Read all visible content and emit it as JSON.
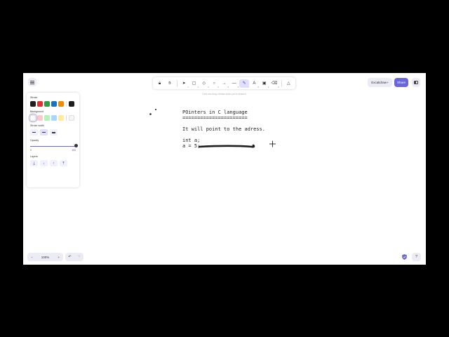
{
  "toolbar": {
    "tools": [
      {
        "name": "lock-tool",
        "glyph": "🔒︎",
        "num": ""
      },
      {
        "name": "hand-tool",
        "glyph": "✋︎",
        "num": ""
      },
      {
        "name": "selection-tool",
        "glyph": "➤",
        "num": "1"
      },
      {
        "name": "rectangle-tool",
        "glyph": "▢",
        "num": "2"
      },
      {
        "name": "diamond-tool",
        "glyph": "◇",
        "num": "3"
      },
      {
        "name": "ellipse-tool",
        "glyph": "○",
        "num": "4"
      },
      {
        "name": "arrow-tool",
        "glyph": "→",
        "num": "5"
      },
      {
        "name": "line-tool",
        "glyph": "—",
        "num": "6"
      },
      {
        "name": "draw-tool",
        "glyph": "✎",
        "num": "7",
        "active": true
      },
      {
        "name": "text-tool",
        "glyph": "A",
        "num": "8"
      },
      {
        "name": "image-tool",
        "glyph": "▣",
        "num": "9"
      },
      {
        "name": "eraser-tool",
        "glyph": "⌫",
        "num": "0"
      },
      {
        "name": "more-tools",
        "glyph": "△",
        "num": ""
      }
    ],
    "hint": "Click and drag, release when you're finished"
  },
  "header": {
    "library_label": "Excalidraw+",
    "share_label": "Share"
  },
  "properties": {
    "stroke_title": "Stroke",
    "stroke_colors": [
      "#1e1e1e",
      "#e03131",
      "#2f9e44",
      "#1971c2",
      "#f08c00"
    ],
    "stroke_current": "#1e1e1e",
    "background_title": "Background",
    "background_colors": [
      "#ffffff",
      "#ffc9c9",
      "#b2f2bb",
      "#a5d8ff",
      "#ffec99"
    ],
    "stroke_width_title": "Stroke width",
    "opacity_title": "Opacity",
    "opacity_min": "0",
    "opacity_max": "100",
    "opacity_value": 100,
    "layers_title": "Layers",
    "layer_glyphs": [
      "⤓",
      "↓",
      "↑",
      "⤒"
    ]
  },
  "canvas": {
    "lines": [
      "POinters in C language",
      "======================",
      "",
      "It will point to the adress.",
      "",
      "int a;",
      "a = 5;"
    ]
  },
  "footer": {
    "zoom_out": "−",
    "zoom_level": "100%",
    "zoom_in": "+",
    "undo": "↶",
    "redo": "↷",
    "help": "?"
  },
  "colors": {
    "accent": "#6965db",
    "ink": "#1e1e1e"
  }
}
